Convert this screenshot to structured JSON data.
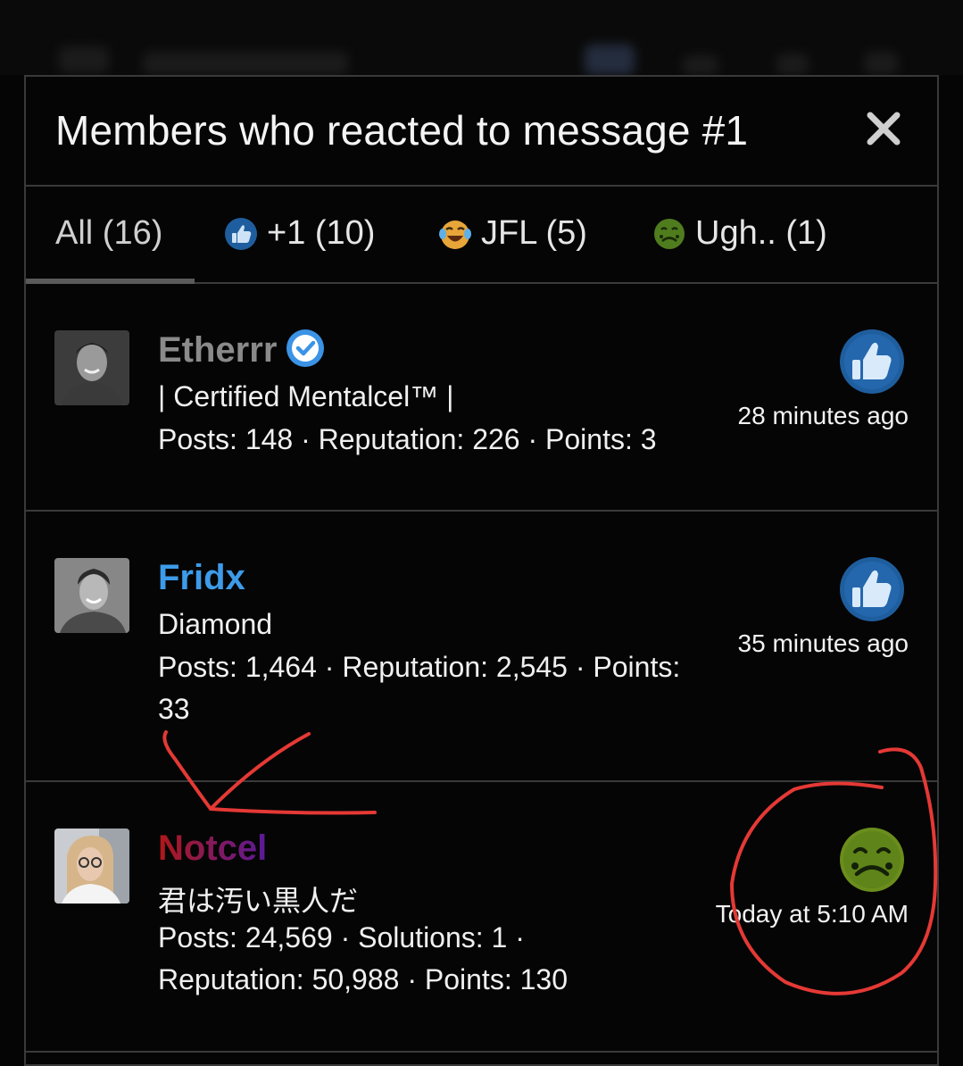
{
  "modal": {
    "title": "Members who reacted to message #1",
    "close_icon": "close-icon"
  },
  "tabs": [
    {
      "label": "All (16)",
      "icon": null,
      "active": true
    },
    {
      "label": "+1 (10)",
      "icon": "thumbs-up-icon",
      "active": false
    },
    {
      "label": "JFL (5)",
      "icon": "laughing-crying-icon",
      "active": false
    },
    {
      "label": "Ugh.. (1)",
      "icon": "nauseated-face-icon",
      "active": false
    }
  ],
  "members": [
    {
      "name": "Etherrr",
      "name_color": "#8a8a8a",
      "verified": true,
      "title": "| Certified Mentalcel™ |",
      "stats_line1": "Posts: 148 · Reputation: 226 · Points: 3",
      "stats_line2": "",
      "reaction_icon": "thumbs-up-icon",
      "time": "28 minutes ago"
    },
    {
      "name": "Fridx",
      "name_color": "#3d9be9",
      "verified": false,
      "title": "Diamond",
      "stats_line1": "Posts: 1,464 · Reputation: 2,545 · Points:",
      "stats_line2": "33",
      "reaction_icon": "thumbs-up-icon",
      "time": "35 minutes ago"
    },
    {
      "name": "Notcel",
      "name_color": "#9b1b1b",
      "verified": false,
      "title": "君は汚い黒人だ",
      "stats_line1": "Posts: 24,569 · Solutions: 1 ·",
      "stats_line2": "Reputation: 50,988 · Points: 130",
      "reaction_icon": "nauseated-face-icon",
      "time": "Today at 5:10 AM"
    }
  ],
  "colors": {
    "accent_blue": "#3d9be9",
    "thumb_blue": "#1f5e9e",
    "nauseated_green": "#6a8d1c",
    "annotation_red": "#e53935"
  }
}
